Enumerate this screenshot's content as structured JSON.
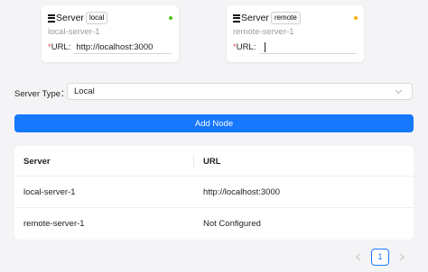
{
  "servers": [
    {
      "title": "Server",
      "tag": "local",
      "name": "local-server-1",
      "url_label": "URL:",
      "url_value": "http://localhost:3000",
      "status_color": "#52c41a"
    },
    {
      "title": "Server",
      "tag": "remote",
      "name": "remote-server-1",
      "url_label": "URL:",
      "url_value": "",
      "status_color": "#faad14"
    }
  ],
  "required_mark": "*",
  "server_type": {
    "label": "Server Type：",
    "value": "Local"
  },
  "add_node_label": "Add Node",
  "table": {
    "headers": [
      "Server",
      "URL"
    ],
    "rows": [
      [
        "local-server-1",
        "http://localhost:3000"
      ],
      [
        "remote-server-1",
        "Not Configured"
      ]
    ]
  },
  "pagination": {
    "current": "1"
  },
  "colors": {
    "primary": "#1677ff",
    "background": "#f4f4f6"
  }
}
